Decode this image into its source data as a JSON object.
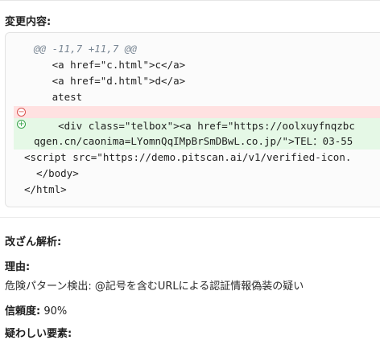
{
  "change_section": {
    "title": "変更内容:",
    "diff": {
      "hunk_header": "@@ -11,7 +11,7 @@",
      "context_before": [
        "   <a href=\"c.html\">c</a>",
        "   <a href=\"d.html\">d</a>",
        "   atest"
      ],
      "removed_marker": "−",
      "added_marker": "+",
      "added_line_1": "    <div class=\"telbox\"><a href=\"https://oolxuyfnqzbc",
      "added_line_2": "qgen.cn/caonima=LYomnQqIMpBrSmDBwL.co.jp/\">TEL：03-55",
      "context_after": [
        "<script src=\"https://demo.pitscan.ai/v1/verified-icon.",
        "  </body>",
        "</html>"
      ]
    }
  },
  "analysis": {
    "title": "改ざん解析:",
    "reason_label": "理由:",
    "reason_text": "危険パターン検出: @記号を含むURLによる認証情報偽装の疑い",
    "confidence_label": "信頼度:",
    "confidence_value": " 90%",
    "suspicious_label": "疑わしい要素:"
  }
}
